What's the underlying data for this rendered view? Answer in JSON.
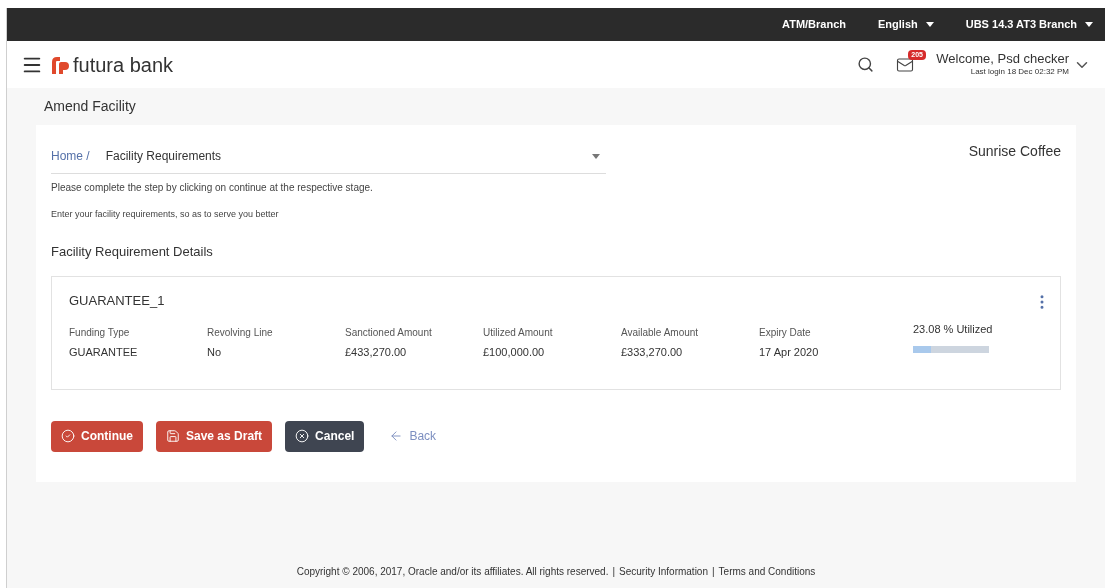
{
  "topbar": {
    "links": [
      {
        "label": "ATM/Branch",
        "dropdown": false
      },
      {
        "label": "English",
        "dropdown": true
      },
      {
        "label": "UBS 14.3 AT3 Branch",
        "dropdown": true
      }
    ]
  },
  "header": {
    "logo": "futura bank",
    "mail_badge": "205",
    "welcome": "Welcome, Psd checker",
    "last_login": "Last login 18 Dec 02:32 PM"
  },
  "page_title": "Amend Facility",
  "company": "Sunrise Coffee",
  "breadcrumb": {
    "home": "Home /",
    "step": "Facility Requirements"
  },
  "instructions": [
    "Please complete the step by clicking on continue at the respective stage.",
    "Enter your facility requirements, so as to serve you better"
  ],
  "section_title": "Facility Requirement Details",
  "facility": {
    "name": "GUARANTEE_1",
    "fields": [
      {
        "label": "Funding Type",
        "value": "GUARANTEE"
      },
      {
        "label": "Revolving Line",
        "value": "No"
      },
      {
        "label": "Sanctioned Amount",
        "value": "£433,270.00"
      },
      {
        "label": "Utilized Amount",
        "value": "£100,000.00"
      },
      {
        "label": "Available Amount",
        "value": "£333,270.00"
      },
      {
        "label": "Expiry Date",
        "value": "17 Apr 2020"
      }
    ],
    "utilization": {
      "label": "23.08 % Utilized",
      "level": 0.2308
    }
  },
  "buttons": [
    {
      "kind": "primary",
      "label": "Continue"
    },
    {
      "kind": "primary",
      "label": "Save as Draft"
    },
    {
      "kind": "dark",
      "label": "Cancel"
    },
    {
      "kind": "link",
      "label": "Back"
    }
  ],
  "footer": {
    "copyright": "Copyright © 2006, 2017, Oracle and/or its affiliates. All rights reserved.",
    "sep": "|",
    "links": [
      "Security Information",
      "Terms and Conditions"
    ]
  }
}
